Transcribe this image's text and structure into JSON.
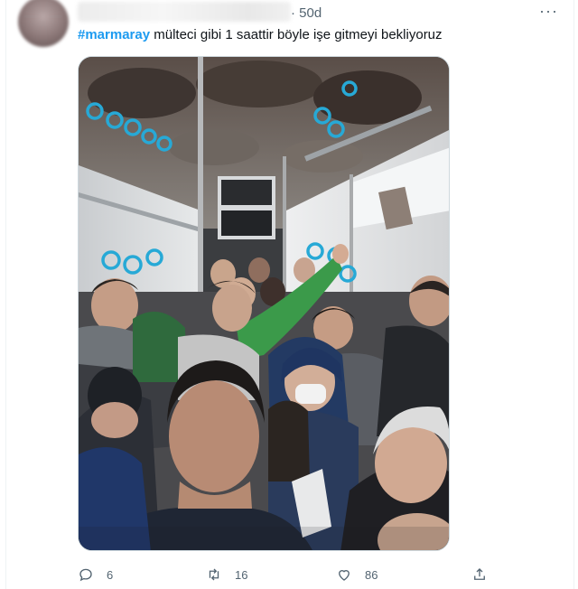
{
  "tweet": {
    "time": "· 50d",
    "hashtag": "#marmaray",
    "text": " mülteci gibi 1 saattir böyle işe gitmeyi bekliyoruz",
    "more_label": "···"
  },
  "actions": {
    "reply_count": "6",
    "retweet_count": "16",
    "like_count": "86"
  },
  "icons": [
    "more-icon",
    "reply-icon",
    "retweet-icon",
    "like-icon",
    "share-icon"
  ],
  "colors": {
    "hashtag": "#1d9bf0",
    "secondary_text": "#536471",
    "border": "#cfd9de"
  }
}
